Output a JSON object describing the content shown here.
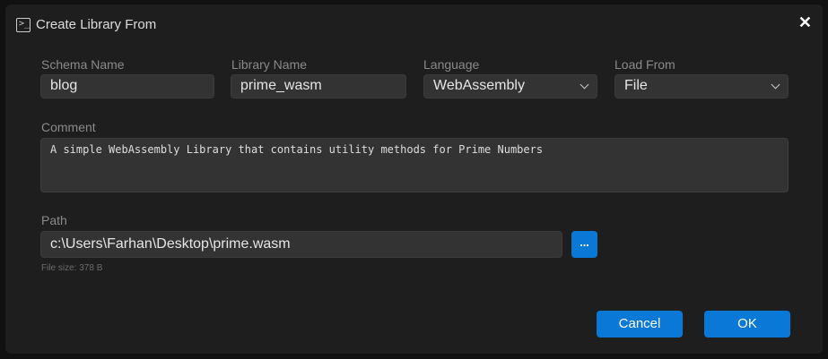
{
  "dialog": {
    "title": "Create Library From",
    "close": "✕"
  },
  "fields": {
    "schema": {
      "label": "Schema Name",
      "value": "blog"
    },
    "library": {
      "label": "Library Name",
      "value": "prime_wasm"
    },
    "language": {
      "label": "Language",
      "value": "WebAssembly"
    },
    "load_from": {
      "label": "Load From",
      "value": "File"
    },
    "comment": {
      "label": "Comment",
      "value": "A simple WebAssembly Library that contains utility methods for Prime Numbers"
    },
    "path": {
      "label": "Path",
      "value": "c:\\Users\\Farhan\\Desktop\\prime.wasm",
      "browse": "...",
      "file_size": "File size: 378 B"
    }
  },
  "buttons": {
    "cancel": "Cancel",
    "ok": "OK"
  }
}
